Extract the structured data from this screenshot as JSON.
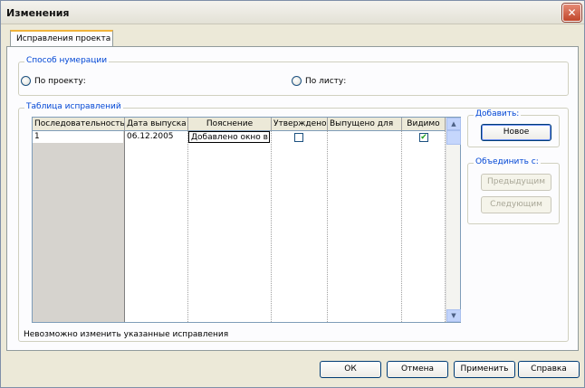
{
  "window": {
    "title": "Изменения",
    "close_glyph": "✕"
  },
  "tab": {
    "label": "Исправления проекта"
  },
  "numbering": {
    "legend": "Способ нумерации",
    "options": [
      {
        "label": "По проекту:",
        "selected": false
      },
      {
        "label": "По листу:",
        "selected": false
      }
    ]
  },
  "revisions": {
    "legend": "Таблица исправлений",
    "columns": [
      "Последовательность",
      "Дата выпуска",
      "Пояснение",
      "Утверждено",
      "Выпущено для",
      "Видимо"
    ],
    "rows": [
      {
        "sequence": "1",
        "date": "06.12.2005",
        "note": "Добавлено окно в",
        "approved": false,
        "issued_for": "",
        "visible": true
      }
    ],
    "footer_note": "Невозможно изменить указанные исправления",
    "scroll_up": "▲",
    "scroll_down": "▼",
    "check_glyph": "✔"
  },
  "add": {
    "legend": "Добавить:",
    "new_label": "Новое"
  },
  "merge": {
    "legend": "Объединить с:",
    "prev_label": "Предыдущим",
    "next_label": "Следующим"
  },
  "footer": {
    "ok": "ОК",
    "cancel": "Отмена",
    "apply": "Применить",
    "help": "Справка"
  }
}
